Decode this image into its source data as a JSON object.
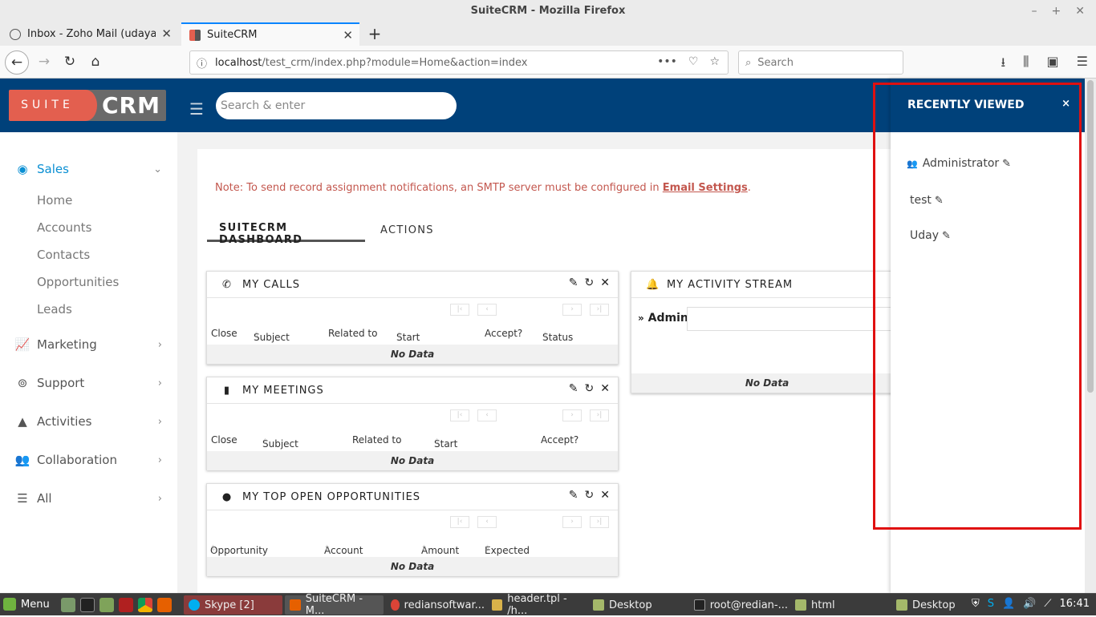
{
  "window": {
    "title": "SuiteCRM - Mozilla Firefox",
    "controls": [
      "–",
      "+",
      "✕"
    ]
  },
  "tabs": [
    {
      "label": "Inbox - Zoho Mail (udayagiri.r",
      "close": "✕"
    },
    {
      "label": "SuiteCRM",
      "close": "✕"
    }
  ],
  "newtab": "+",
  "nav": {
    "back": "←",
    "forward": "→",
    "reload": "↻",
    "home": "⌂",
    "info": "ⓘ",
    "url_host": "localhost",
    "url_path": "/test_crm/index.php?module=Home&action=index",
    "page_actions": [
      "•••",
      "♡",
      "☆"
    ],
    "search_placeholder": "Search",
    "tool_icons": [
      "⭳",
      "⫼",
      "▣",
      "☰"
    ]
  },
  "crm": {
    "logo_suite": "SUITE",
    "logo_crm": "CRM",
    "menu_icon": "☰",
    "search_placeholder": "Search & enter"
  },
  "sidebar": {
    "groups": [
      {
        "label": "Sales",
        "icon": "◉",
        "chevron": "⌄"
      },
      {
        "label": "Marketing",
        "icon": "📈",
        "chevron": "›"
      },
      {
        "label": "Support",
        "icon": "⊚",
        "chevron": "›"
      },
      {
        "label": "Activities",
        "icon": "▲",
        "chevron": "›"
      },
      {
        "label": "Collaboration",
        "icon": "👥",
        "chevron": "›"
      },
      {
        "label": "All",
        "icon": "☰",
        "chevron": "›"
      }
    ],
    "sales_items": [
      "Home",
      "Accounts",
      "Contacts",
      "Opportunities",
      "Leads"
    ]
  },
  "note": {
    "text": "Note: To send record assignment notifications, an SMTP server must be configured in ",
    "link": "Email Settings",
    "end": "."
  },
  "dashboard_tabs": [
    "SUITECRM DASHBOARD",
    "ACTIONS"
  ],
  "dashlets": {
    "tool_icons": [
      "✎",
      "↻",
      "✕"
    ],
    "pager": [
      "|‹",
      "‹",
      "›",
      "›|"
    ],
    "sort_icon": "⇳",
    "no_data": "No Data",
    "calls": {
      "icon": "✆",
      "title": "MY CALLS",
      "columns": [
        "Close",
        "Subject",
        "Related to",
        "Start Date",
        "Accept?",
        "Status"
      ]
    },
    "meetings": {
      "icon": "▮",
      "title": "MY MEETINGS",
      "columns": [
        "Close",
        "Subject",
        "Related to",
        "Start Date",
        "Accept?"
      ]
    },
    "opps": {
      "icon": "●",
      "title": "MY TOP OPEN OPPORTUNITIES",
      "columns": [
        "Opportunity Name",
        "Account Name",
        "Amount",
        "Expected Close Date"
      ]
    },
    "activity": {
      "icon": "🔔",
      "title": "MY ACTIVITY STREAM",
      "user": "Admin",
      "toggle": "»"
    }
  },
  "recently_viewed": {
    "title": "RECENTLY VIEWED",
    "close": "×",
    "items": [
      {
        "label": "Administrator",
        "icon": "👥"
      },
      {
        "label": "test"
      },
      {
        "label": "Uday"
      }
    ],
    "edit_icon": "✎"
  },
  "taskbar": {
    "menu_label": "Menu",
    "windows": [
      "Skype [2]",
      "SuiteCRM - M...",
      "rediansoftwar...",
      "header.tpl - /h...",
      "Desktop",
      "root@redian-...",
      "html",
      "Desktop"
    ],
    "clock": "16:41"
  },
  "colors": {
    "header_blue": "#00417a",
    "logo_red": "#e35f4f",
    "accent_blue": "#0a8fd3",
    "note_red": "#c3574e",
    "highlight_red": "#e01010"
  }
}
